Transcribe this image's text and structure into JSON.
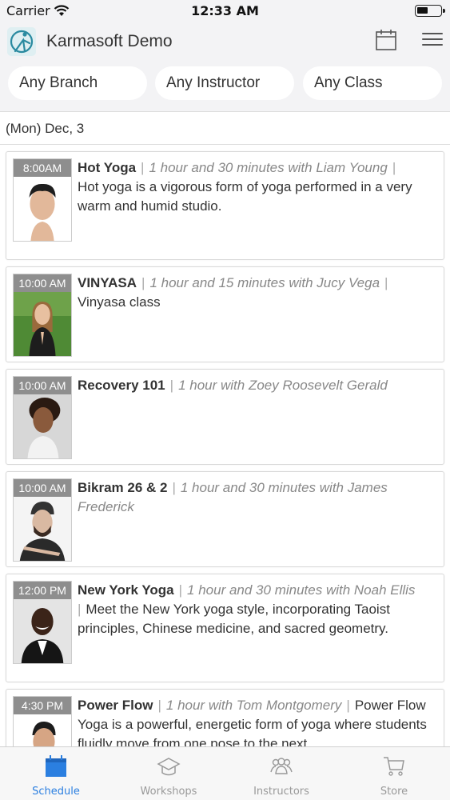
{
  "status_bar": {
    "carrier": "Carrier",
    "time": "12:33 AM"
  },
  "app": {
    "title": "Karmasoft Demo"
  },
  "filters": [
    {
      "label": "Any Branch"
    },
    {
      "label": "Any Instructor"
    },
    {
      "label": "Any Class"
    }
  ],
  "date": "(Mon) Dec, 3",
  "classes": [
    {
      "time": "8:00AM",
      "name": "Hot Yoga",
      "meta": "1 hour and 30 minutes with Liam Young",
      "description": "Hot yoga is a vigorous form of yoga performed in a very warm and humid studio."
    },
    {
      "time": "10:00 AM",
      "name": "VINYASA",
      "meta": "1 hour and 15 minutes with Jucy Vega",
      "description": "Vinyasa class"
    },
    {
      "time": "10:00 AM",
      "name": "Recovery 101",
      "meta": "1 hour with Zoey Roosevelt Gerald",
      "description": ""
    },
    {
      "time": "10:00 AM",
      "name": "Bikram 26 & 2",
      "meta": "1 hour and 30 minutes with James Frederick",
      "description": ""
    },
    {
      "time": "12:00 PM",
      "name": "New York Yoga",
      "meta": "1 hour and 30 minutes with Noah Ellis",
      "description": "Meet the New York yoga style, incorporating Taoist principles, Chinese medicine, and sacred geometry."
    },
    {
      "time": "4:30 PM",
      "name": "Power Flow",
      "meta": "1 hour with Tom Montgomery",
      "description": "Power Flow Yoga is a powerful, energetic form of yoga where students fluidly move from one pose to the next"
    }
  ],
  "tabs": [
    {
      "label": "Schedule",
      "icon": "calendar-icon",
      "active": true
    },
    {
      "label": "Workshops",
      "icon": "graduation-cap-icon",
      "active": false
    },
    {
      "label": "Instructors",
      "icon": "people-icon",
      "active": false
    },
    {
      "label": "Store",
      "icon": "cart-icon",
      "active": false
    }
  ],
  "colors": {
    "accent": "#2b7fe0",
    "time_badge": "#8e8e8e",
    "background": "#f3f3f5"
  }
}
